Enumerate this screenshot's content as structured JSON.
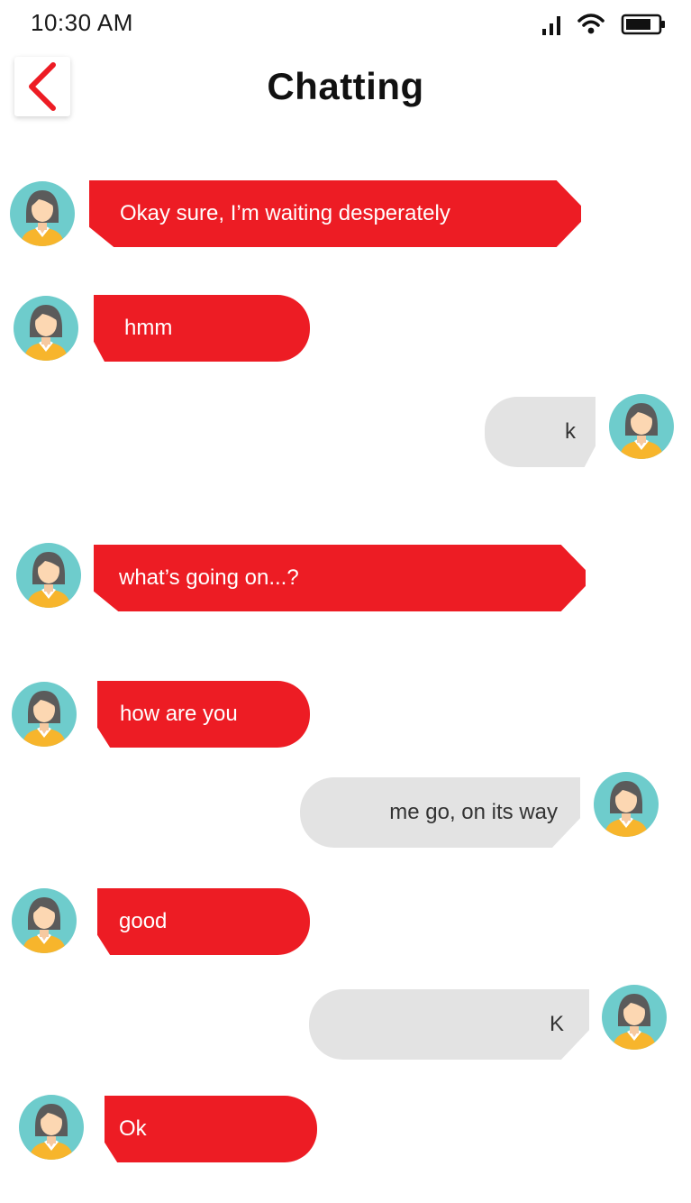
{
  "status_bar": {
    "time": "10:30 AM",
    "icons": [
      "signal-icon",
      "wifi-icon",
      "battery-icon"
    ]
  },
  "header": {
    "title": "Chatting",
    "back_icon": "chevron-left-icon"
  },
  "colors": {
    "accent": "#ed1c24",
    "sent_bubble": "#e3e3e3",
    "avatar_bg": "#6ecccc",
    "avatar_shirt": "#f7b52c"
  },
  "messages": [
    {
      "from": "other",
      "text": "Okay sure, I’m waiting desperately"
    },
    {
      "from": "other",
      "text": "hmm"
    },
    {
      "from": "me",
      "text": "k"
    },
    {
      "from": "other",
      "text": "what’s going on...?"
    },
    {
      "from": "other",
      "text": "how are you"
    },
    {
      "from": "me",
      "text": "me go, on its way"
    },
    {
      "from": "other",
      "text": "good"
    },
    {
      "from": "me",
      "text": "K"
    },
    {
      "from": "other",
      "text": "Ok"
    }
  ]
}
